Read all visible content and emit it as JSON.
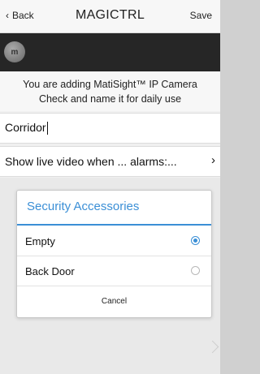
{
  "navbar": {
    "back_label": "Back",
    "back_chevron": "‹",
    "title": "MAGICTRL",
    "save_label": "Save"
  },
  "header": {
    "avatar_icon": "camera-logo-icon",
    "avatar_text": "m"
  },
  "info": {
    "line1": "You are adding MatiSight™ IP Camera",
    "line2": "Check and name it for daily use"
  },
  "name_field": {
    "value": "Corridor"
  },
  "alarm_row": {
    "label": "Show live video when ... alarms:...",
    "chevron": "›"
  },
  "dialog": {
    "title": "Security Accessories",
    "accent_color": "#3b8fd6",
    "options": [
      {
        "label": "Empty",
        "selected": true
      },
      {
        "label": "Back Door",
        "selected": false
      }
    ],
    "cancel_label": "Cancel"
  }
}
